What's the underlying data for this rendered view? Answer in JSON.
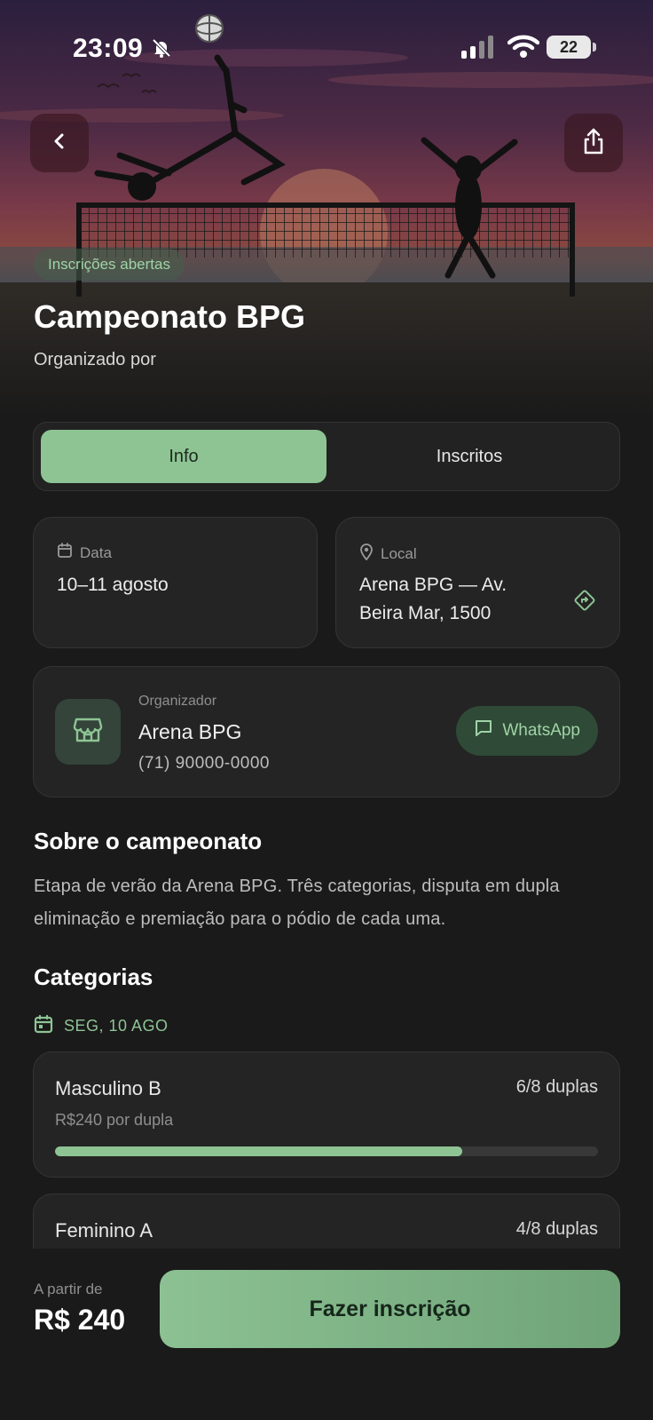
{
  "status_bar": {
    "time": "23:09",
    "battery": "22"
  },
  "hero": {
    "badge": "Inscrições abertas",
    "title": "Campeonato BPG",
    "organized_by": "Organizado por"
  },
  "tabs": [
    {
      "label": "Info",
      "active": true
    },
    {
      "label": "Inscritos",
      "active": false
    }
  ],
  "date_card": {
    "label": "Data",
    "value": "10–11 agosto"
  },
  "local_card": {
    "label": "Local",
    "value": "Arena BPG — Av. Beira Mar, 1500"
  },
  "organizer": {
    "label": "Organizador",
    "name": "Arena BPG",
    "phone": "(71) 90000-0000",
    "whatsapp_label": "WhatsApp"
  },
  "about": {
    "title": "Sobre o campeonato",
    "text": "Etapa de verão da Arena BPG. Três categorias, disputa em dupla eliminação e premiação para o pódio de cada uma."
  },
  "categories": {
    "title": "Categorias",
    "day": "SEG, 10 AGO",
    "items": [
      {
        "name": "Masculino B",
        "count": "6/8 duplas",
        "price": "R$240 por dupla",
        "filled_fraction": 0.75
      },
      {
        "name": "Feminino A",
        "count": "4/8 duplas"
      }
    ]
  },
  "footer": {
    "from_label": "A partir de",
    "price": "R$ 240",
    "cta": "Fazer inscrição"
  },
  "colors": {
    "accent": "#8ec494",
    "background": "#1a1a1a",
    "card": "#242424"
  }
}
